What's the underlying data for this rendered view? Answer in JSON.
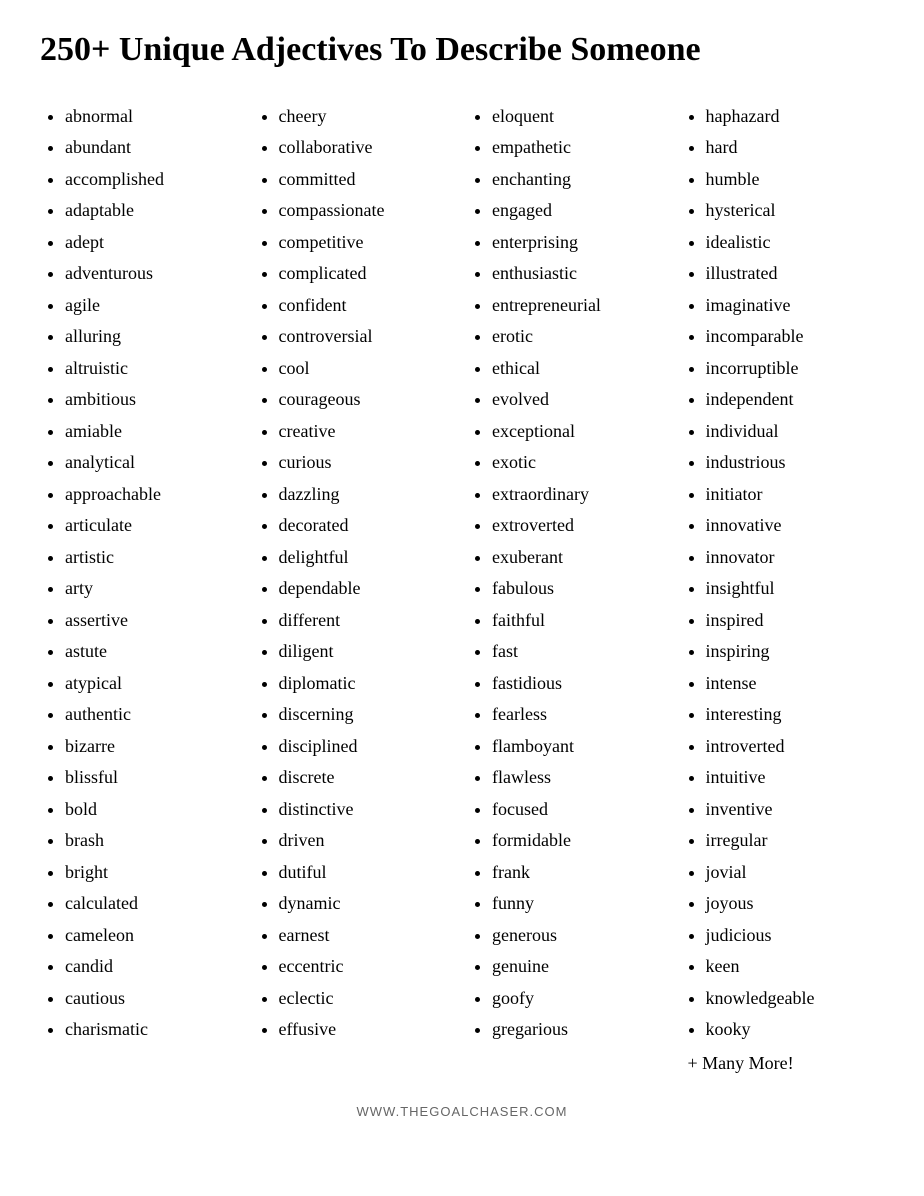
{
  "title": "250+ Unique Adjectives To Describe Someone",
  "columns": [
    {
      "id": "col1",
      "items": [
        "abnormal",
        "abundant",
        "accomplished",
        "adaptable",
        "adept",
        "adventurous",
        "agile",
        "alluring",
        "altruistic",
        "ambitious",
        "amiable",
        "analytical",
        "approachable",
        "articulate",
        "artistic",
        "arty",
        "assertive",
        "astute",
        "atypical",
        "authentic",
        "bizarre",
        "blissful",
        "bold",
        "brash",
        "bright",
        "calculated",
        "cameleon",
        "candid",
        "cautious",
        "charismatic"
      ]
    },
    {
      "id": "col2",
      "items": [
        "cheery",
        "collaborative",
        "committed",
        "compassionate",
        "competitive",
        "complicated",
        "confident",
        "controversial",
        "cool",
        "courageous",
        "creative",
        "curious",
        "dazzling",
        "decorated",
        "delightful",
        "dependable",
        "different",
        "diligent",
        "diplomatic",
        "discerning",
        "disciplined",
        "discrete",
        "distinctive",
        "driven",
        "dutiful",
        "dynamic",
        "earnest",
        "eccentric",
        "eclectic",
        "effusive"
      ]
    },
    {
      "id": "col3",
      "items": [
        "eloquent",
        "empathetic",
        "enchanting",
        "engaged",
        "enterprising",
        "enthusiastic",
        "entrepreneurial",
        "erotic",
        "ethical",
        "evolved",
        "exceptional",
        "exotic",
        "extraordinary",
        "extroverted",
        "exuberant",
        "fabulous",
        "faithful",
        "fast",
        "fastidious",
        "fearless",
        "flamboyant",
        "flawless",
        "focused",
        "formidable",
        "frank",
        "funny",
        "generous",
        "genuine",
        "goofy",
        "gregarious"
      ]
    },
    {
      "id": "col4",
      "items": [
        "haphazard",
        "hard",
        "humble",
        "hysterical",
        "idealistic",
        "illustrated",
        "imaginative",
        "incomparable",
        "incorruptible",
        "independent",
        "individual",
        "industrious",
        "initiator",
        "innovative",
        "innovator",
        "insightful",
        "inspired",
        "inspiring",
        "intense",
        "interesting",
        "introverted",
        "intuitive",
        "inventive",
        "irregular",
        "jovial",
        "joyous",
        "judicious",
        "keen",
        "knowledgeable",
        "kooky"
      ]
    }
  ],
  "more_label": "+ Many More!",
  "footer": "WWW.THEGOALCHASER.COM"
}
